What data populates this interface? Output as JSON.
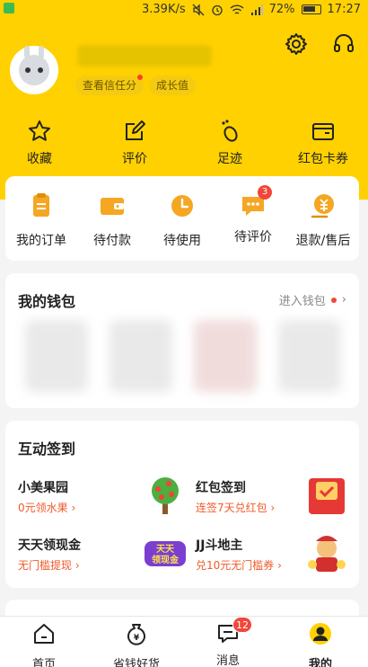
{
  "status_bar": {
    "speed": "3.39K/s",
    "battery": "72%",
    "time": "17:27"
  },
  "header": {
    "chips": {
      "trust": "查看信任分",
      "growth": "成长值"
    }
  },
  "quick_actions": [
    {
      "label": "收藏",
      "icon": "star-icon"
    },
    {
      "label": "评价",
      "icon": "edit-icon"
    },
    {
      "label": "足迹",
      "icon": "footprint-icon"
    },
    {
      "label": "红包卡券",
      "icon": "wallet-icon"
    }
  ],
  "orders": [
    {
      "label": "我的订单",
      "icon": "order-list-icon"
    },
    {
      "label": "待付款",
      "icon": "wallet-payment-icon"
    },
    {
      "label": "待使用",
      "icon": "clock-icon"
    },
    {
      "label": "待评价",
      "icon": "comment-icon",
      "badge": "3"
    },
    {
      "label": "退款/售后",
      "icon": "refund-icon"
    }
  ],
  "wallet": {
    "title": "我的钱包",
    "link": "进入钱包"
  },
  "interact": {
    "title": "互动签到",
    "items": [
      {
        "title": "小美果园",
        "sub": "0元领水果 ›",
        "icon": "fruit-tree-icon"
      },
      {
        "title": "红包签到",
        "sub": "连签7天兑红包 ›",
        "icon": "red-envelope-icon"
      },
      {
        "title": "天天领现金",
        "sub": "无门槛提现 ›",
        "icon": "cash-game-icon"
      },
      {
        "title": "JJ斗地主",
        "sub": "兑10元无门槛券 ›",
        "icon": "card-game-icon"
      }
    ],
    "game_logo_text": "天天领现金"
  },
  "tabbar": [
    {
      "label": "首页",
      "icon": "home-icon"
    },
    {
      "label": "省钱好货",
      "icon": "money-bag-icon"
    },
    {
      "label": "消息",
      "icon": "message-icon",
      "badge": "12"
    },
    {
      "label": "我的",
      "icon": "profile-icon",
      "active": true
    }
  ],
  "colors": {
    "brand_yellow": "#ffd100",
    "accent_orange": "#f5a623",
    "badge_red": "#f2463a"
  }
}
